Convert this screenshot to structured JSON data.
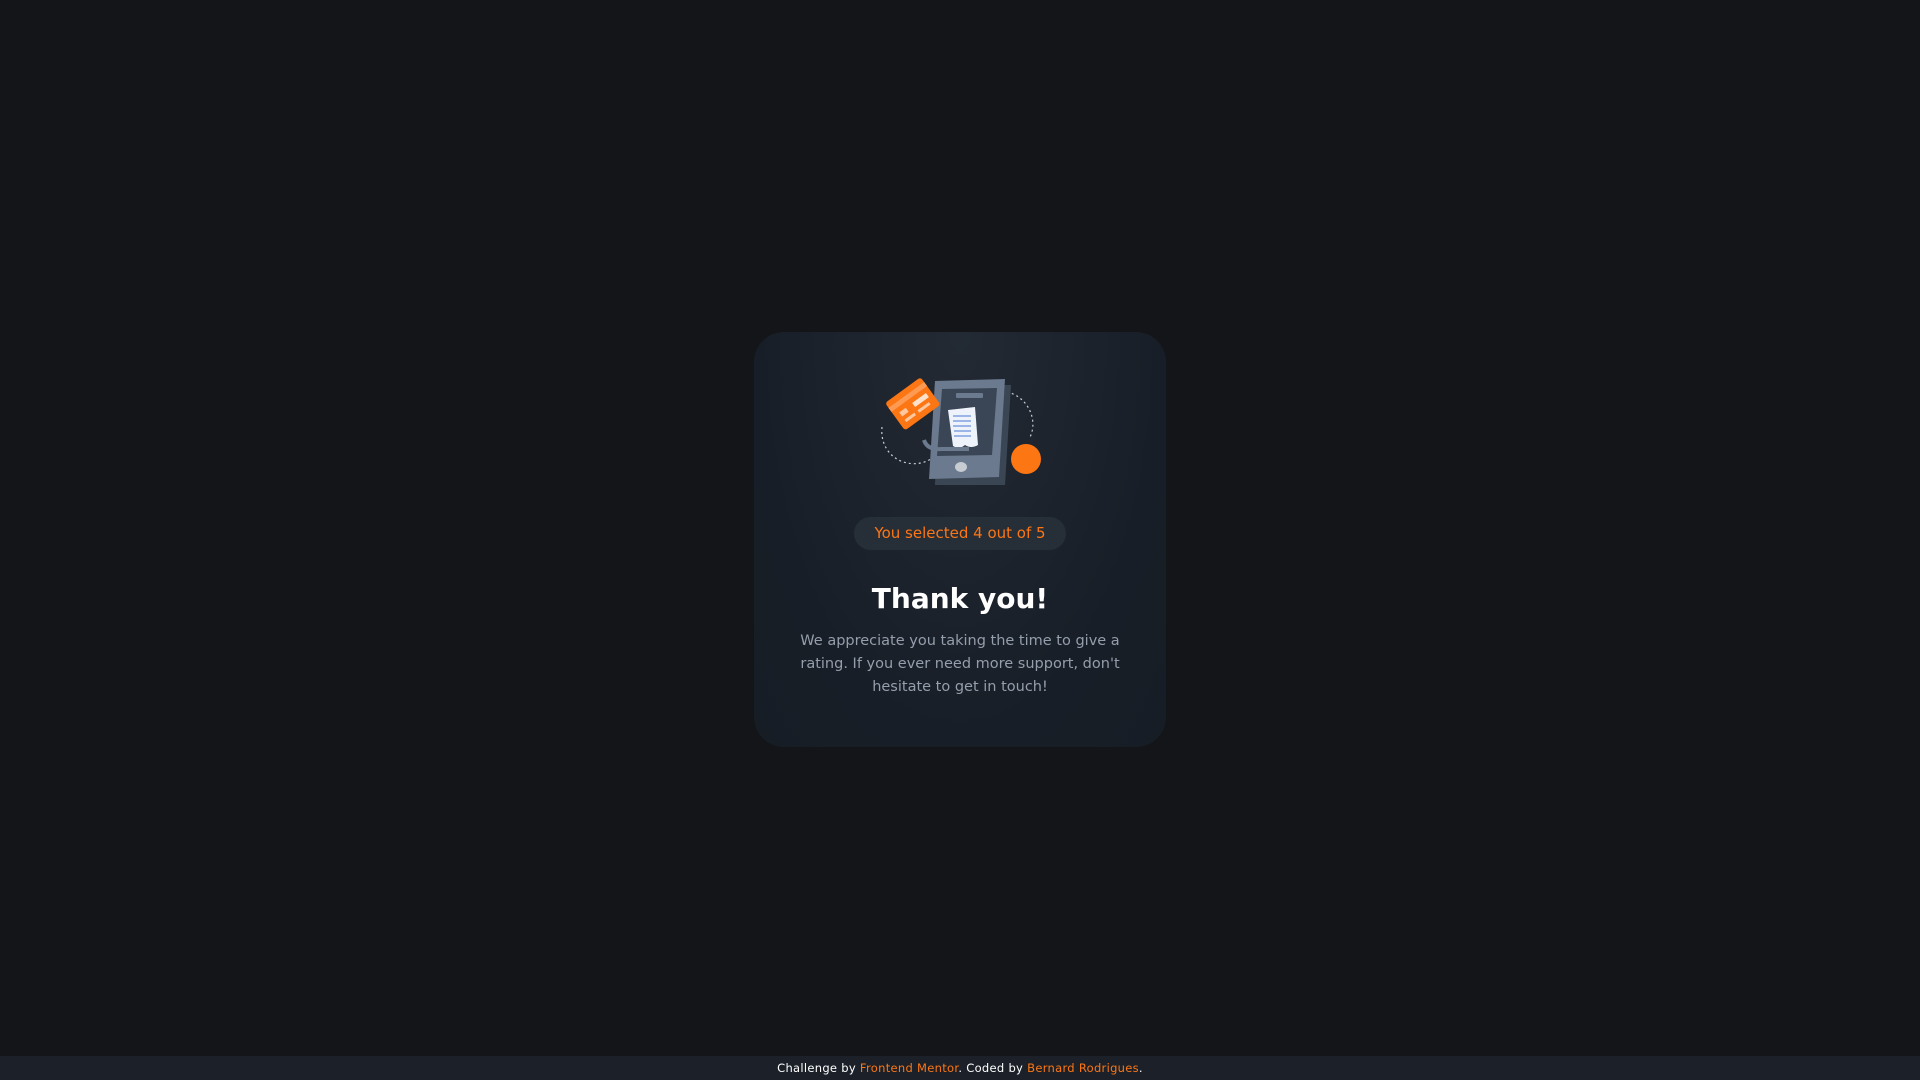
{
  "card": {
    "selected_text": "You selected 4 out of 5",
    "title": "Thank you!",
    "message": "We appreciate you taking the time to give a rating. If you ever need more support, don't hesitate to get in touch!"
  },
  "attribution": {
    "challenge_prefix": "Challenge by ",
    "challenge_link": "Frontend Mentor",
    "coded_prefix": ". Coded by ",
    "author_link": "Bernard Rodrigues",
    "suffix": "."
  },
  "rating": {
    "selected": 4,
    "max": 5
  },
  "colors": {
    "background": "#131518",
    "card": "#1b222b",
    "accent": "#fc7614",
    "heading": "#ffffff",
    "body_text": "#959eac",
    "footer_bar": "#1c2129"
  },
  "icons": {
    "illustration": "thank-you-phone-illustration"
  }
}
